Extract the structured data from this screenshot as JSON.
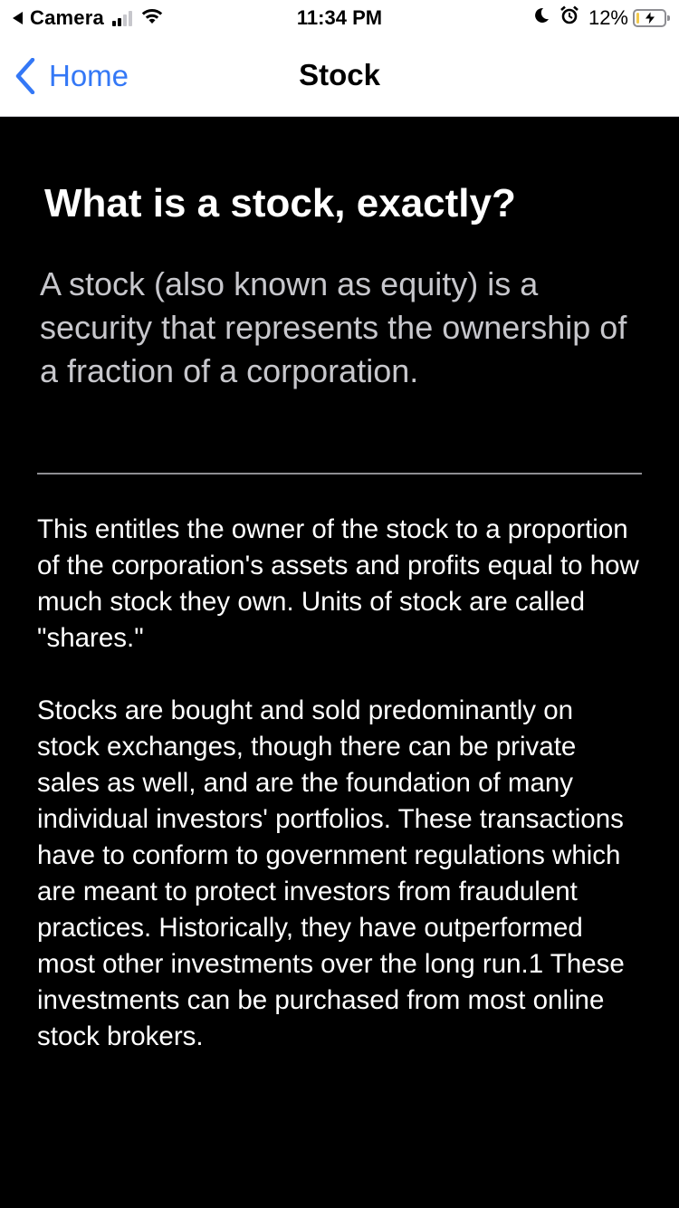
{
  "status_bar": {
    "carrier": "Camera",
    "time": "11:34 PM",
    "battery_percent": "12%",
    "battery_level": 0.12,
    "icons": [
      "back-to-app-icon",
      "cellular-signal-icon",
      "wifi-icon",
      "moon-icon",
      "alarm-icon",
      "battery-charging-icon"
    ]
  },
  "nav": {
    "back_label": "Home",
    "back_icon": "chevron-left-icon",
    "title": "Stock",
    "accent_color": "#3478f6"
  },
  "article": {
    "heading": "What is a stock, exactly?",
    "subtitle": "A stock (also known as equity) is a security that represents the ownership of a fraction of a corporation.",
    "body": "This entitles the owner of the stock to a proportion of the corporation's assets and profits equal to how much stock they own. Units of stock are called \"shares.\"\n\nStocks are bought and sold predominantly on stock exchanges, though there can be private sales as well, and are the foundation of many individual investors' portfolios. These transactions have to conform to government regulations which are meant to protect investors from fraudulent practices. Historically, they have outperformed most other investments over the long run.1 These investments can be purchased from most online stock brokers."
  },
  "colors": {
    "background": "#000000",
    "heading": "#ffffff",
    "subtitle": "#c7c7cc",
    "body": "#ffffff"
  }
}
